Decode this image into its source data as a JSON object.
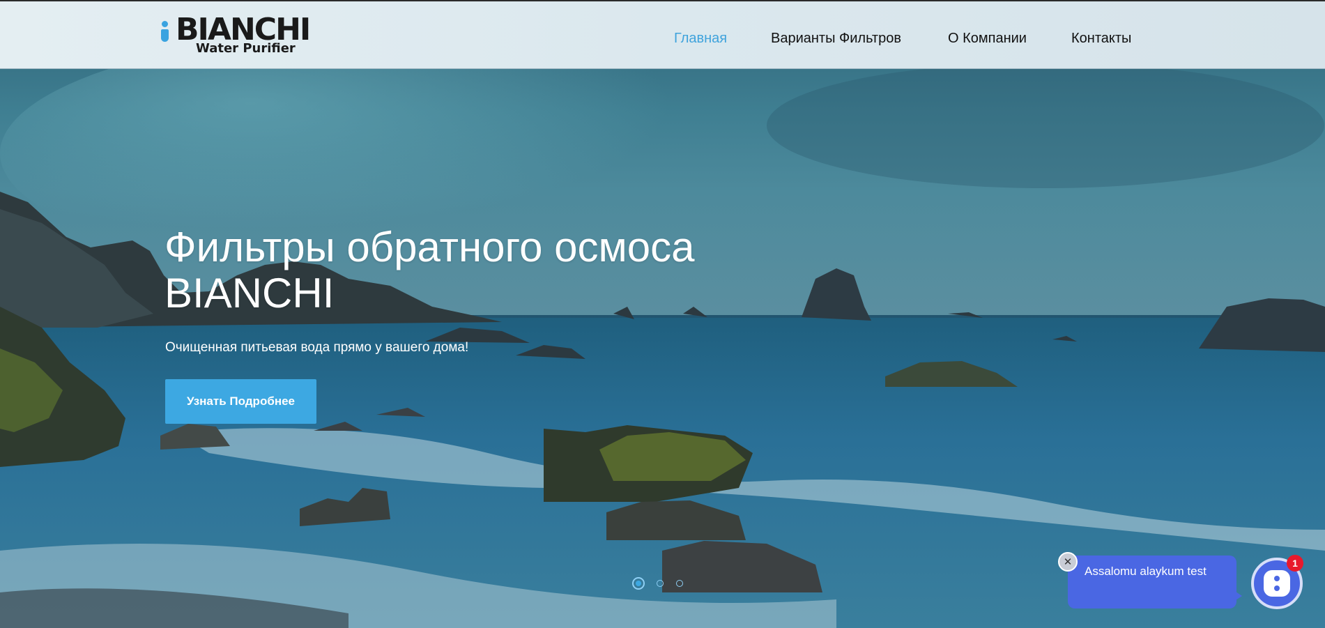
{
  "logo": {
    "brand": "BIANCHI",
    "tagline": "Water Purifier"
  },
  "nav": {
    "items": [
      {
        "label": "Главная",
        "active": true
      },
      {
        "label": "Варианты Фильтров",
        "active": false
      },
      {
        "label": "О Компании",
        "active": false
      },
      {
        "label": "Контакты",
        "active": false
      }
    ]
  },
  "hero": {
    "title_line1": "Фильтры обратного осмоса",
    "title_line2": "BIANCHI",
    "subtitle": "Очищенная питьевая вода прямо у вашего дома!",
    "cta_label": "Узнать Подробнее",
    "slides_count": 3,
    "active_slide": 1
  },
  "chat": {
    "message": "Assalomu alaykum test",
    "close_icon": "close-icon",
    "launcher_icon": "chat-icon",
    "unread_count": "1"
  },
  "colors": {
    "accent": "#3da8e2",
    "nav_active": "#3fa3dc",
    "chat": "#4a67e3",
    "badge": "#e8192c"
  }
}
